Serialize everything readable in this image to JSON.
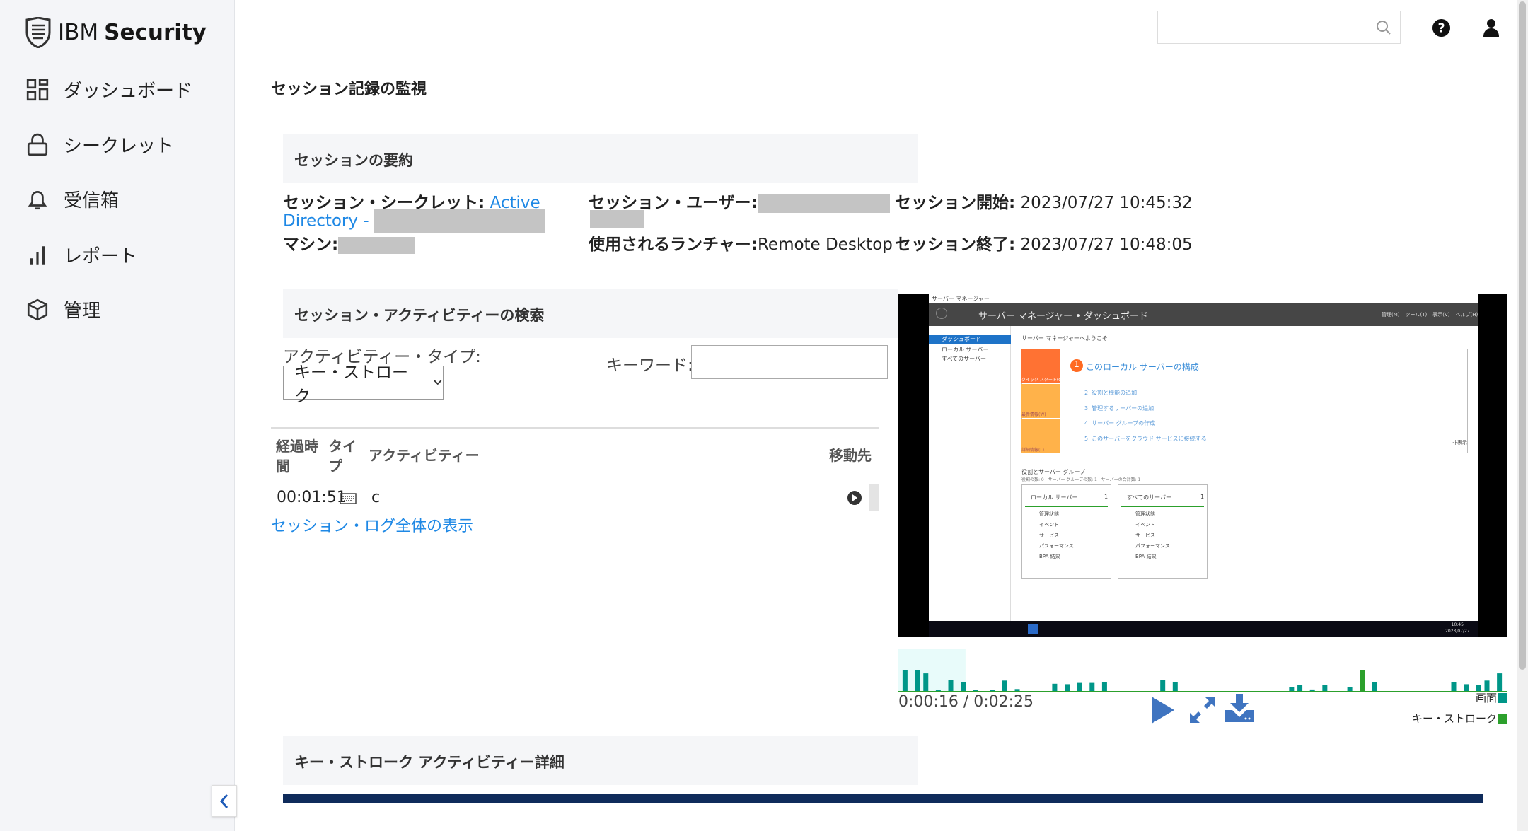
{
  "brand": {
    "name_light": "IBM",
    "name_bold": "Security"
  },
  "sidebar": {
    "items": [
      {
        "label": "ダッシュボード",
        "icon": "dashboard-grid-icon"
      },
      {
        "label": "シークレット",
        "icon": "lock-icon"
      },
      {
        "label": "受信箱",
        "icon": "bell-icon"
      },
      {
        "label": "レポート",
        "icon": "bar-chart-icon"
      },
      {
        "label": "管理",
        "icon": "cube-icon"
      }
    ]
  },
  "header": {
    "search_placeholder": "",
    "icons": [
      "search-icon",
      "help-icon",
      "user-icon"
    ]
  },
  "page_title": "セッション記録の監視",
  "summary": {
    "title": "セッションの要約",
    "secret_label": "セッション・シークレット:",
    "secret_value_1": "Active",
    "secret_value_2": "Directory -",
    "machine_label": "マシン:",
    "user_label": "セッション・ユーザー:",
    "launcher_label": "使用されるランチャー:",
    "launcher_value": "Remote Desktop",
    "start_label": "セッション開始:",
    "start_value": "2023/07/27 10:45:32",
    "end_label": "セッション終了:",
    "end_value": "2023/07/27 10:48:05"
  },
  "search": {
    "title": "セッション・アクティビティーの検索",
    "type_label": "アクティビティー・タイプ:",
    "type_value": "キー・ストローク",
    "keyword_label": "キーワード:",
    "keyword_value": ""
  },
  "table": {
    "columns": [
      "経過時間",
      "タイプ",
      "アクティビティー",
      "移動先"
    ],
    "col0_line1": "経過時",
    "col0_line2": "間",
    "col1_line1": "タイ",
    "col1_line2": "プ",
    "rows": [
      {
        "elapsed": "00:01:51",
        "type_icon": "keyboard-icon",
        "activity": "c",
        "goto_icon": "play-circle-icon"
      }
    ]
  },
  "view_log_link": "セッション・ログ全体の表示",
  "player": {
    "screenshot": {
      "window_title": "サーバー マネージャー",
      "breadcrumb": "サーバー マネージャー • ダッシュボード",
      "menu": [
        "管理(M)",
        "ツール(T)",
        "表示(V)",
        "ヘルプ(H)"
      ],
      "nav": [
        "ダッシュボード",
        "ローカル サーバー",
        "すべてのサーバー"
      ],
      "welcome": "サーバー マネージャーへようこそ",
      "tiles": [
        "クイック スタート(Q)",
        "最新情報(W)",
        "詳細情報(L)"
      ],
      "step1": "このローカル サーバーの構成",
      "steps": [
        "役割と機能の追加",
        "管理するサーバーの追加",
        "サーバー グループの作成",
        "このサーバーをクラウド サービスに接続する"
      ],
      "hide": "非表示",
      "groups_title": "役割とサーバー グループ",
      "groups_sub": "役割の数: 0 | サーバー グループの数: 1 | サーバーの合計数: 1",
      "cards": [
        {
          "title": "ローカル サーバー",
          "count": "1"
        },
        {
          "title": "すべてのサーバー",
          "count": "1"
        }
      ],
      "card_items": [
        "管理状態",
        "イベント",
        "サービス",
        "パフォーマンス",
        "BPA 結果"
      ],
      "clock_time": "10:45",
      "clock_date": "2023/07/27"
    },
    "time_current": "0:00:16",
    "time_total": "0:02:25",
    "time_display": "0:00:16 / 0:02:25",
    "controls": [
      "play-icon",
      "fullscreen-icon",
      "download-icon"
    ],
    "legend": [
      {
        "label": "画面",
        "color": "#009688"
      },
      {
        "label": "キー・ストローク",
        "color": "#2ca02c"
      }
    ],
    "timeline": {
      "duration_s": 145,
      "played_s": 16,
      "events": [
        [
          1,
          1,
          "s"
        ],
        [
          4,
          1,
          "s"
        ],
        [
          6,
          0.83,
          "s"
        ],
        [
          9,
          0.02,
          "s"
        ],
        [
          12,
          0.51,
          "s"
        ],
        [
          15,
          0.4,
          "s"
        ],
        [
          18,
          0.02,
          "s"
        ],
        [
          22,
          0.02,
          "s"
        ],
        [
          25,
          0.49,
          "s"
        ],
        [
          28,
          0.09,
          "s"
        ],
        [
          37,
          0.34,
          "s"
        ],
        [
          40,
          0.32,
          "s"
        ],
        [
          43,
          0.38,
          "s"
        ],
        [
          46,
          0.38,
          "s"
        ],
        [
          49,
          0.42,
          "s"
        ],
        [
          63,
          0.52,
          "s"
        ],
        [
          66,
          0.42,
          "s"
        ],
        [
          94,
          0.17,
          "s"
        ],
        [
          96,
          0.3,
          "s"
        ],
        [
          99,
          0.07,
          "s"
        ],
        [
          102,
          0.3,
          "s"
        ],
        [
          108,
          0.17,
          "s"
        ],
        [
          111,
          1,
          "k"
        ],
        [
          114,
          0.42,
          "s"
        ],
        [
          133,
          0.42,
          "s"
        ],
        [
          136,
          0.32,
          "s"
        ],
        [
          139,
          0.28,
          "s"
        ],
        [
          141,
          0.49,
          "s"
        ],
        [
          144,
          0.83,
          "s"
        ]
      ]
    }
  },
  "keystroke_detail": {
    "title": "キー・ストローク アクティビティー詳細"
  },
  "colors": {
    "link": "#1e88e5",
    "screen": "#009688",
    "keystroke": "#2ca02c",
    "control": "#3f74c0",
    "bar": "#0f2b5b"
  }
}
